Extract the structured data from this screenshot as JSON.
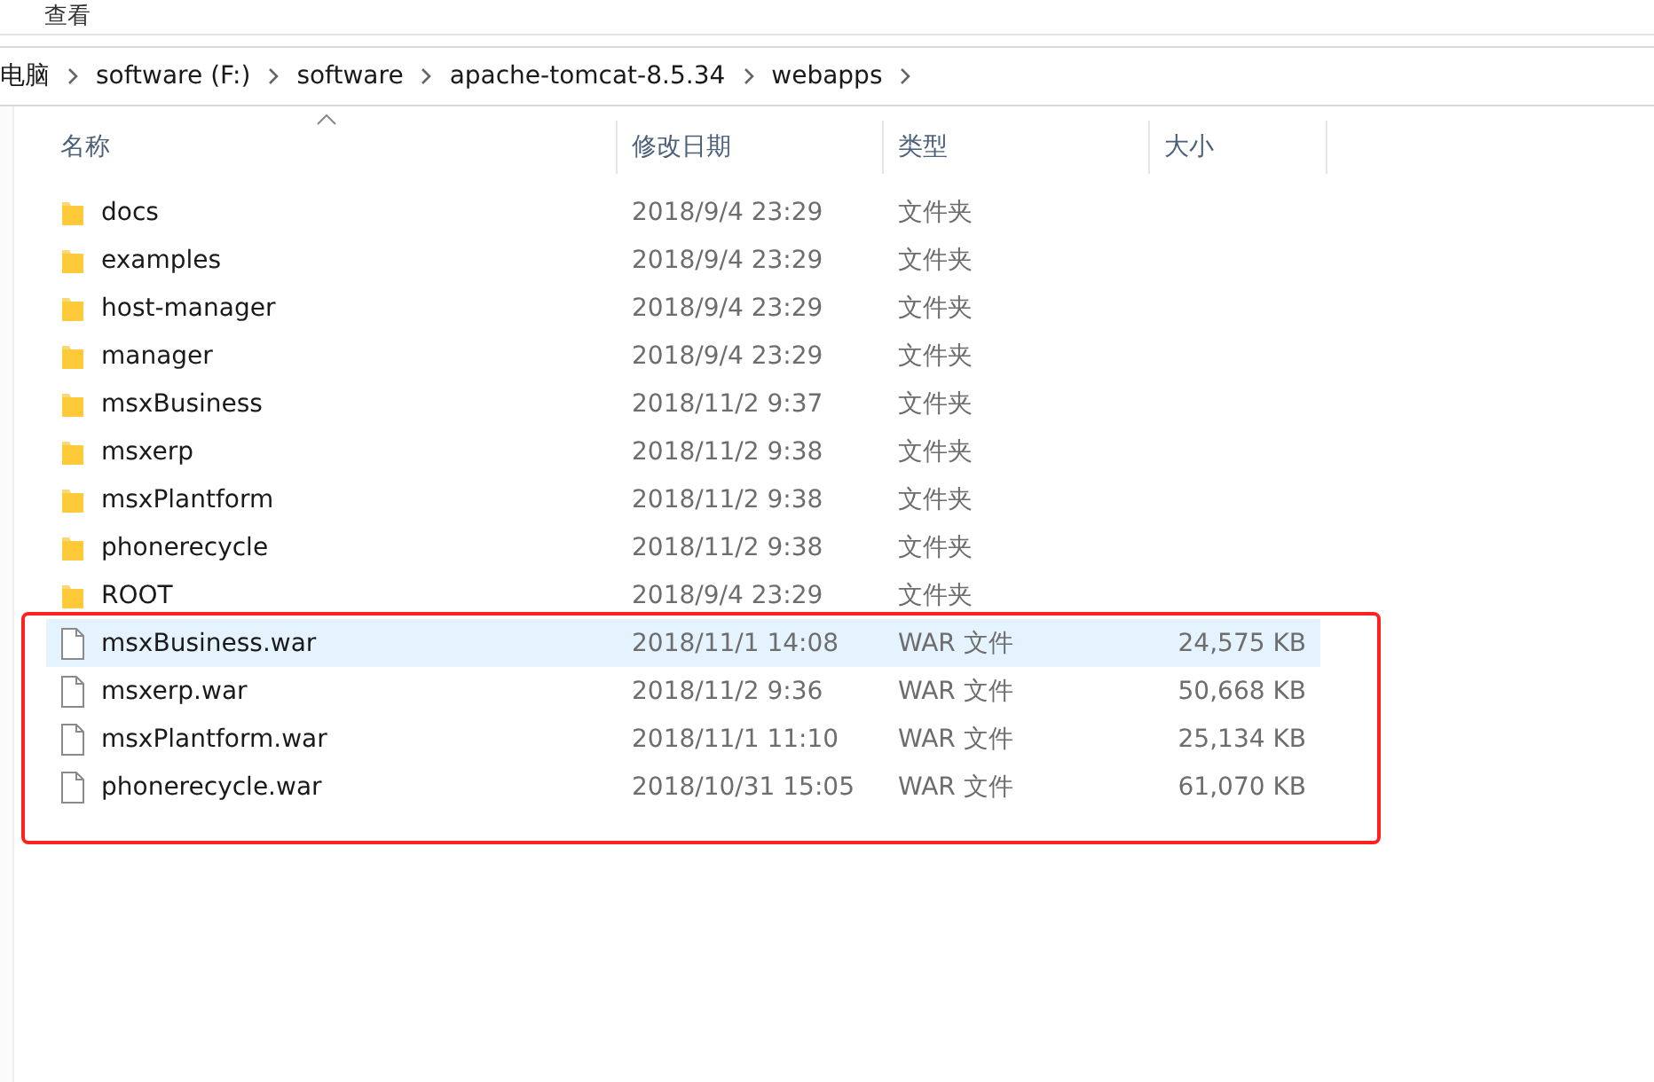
{
  "ribbon": {
    "tab": "查看"
  },
  "address": {
    "crumbs": [
      "电脑",
      "software (F:)",
      "software",
      "apache-tomcat-8.5.34",
      "webapps"
    ]
  },
  "columns": [
    {
      "label": "名称",
      "sorted": true
    },
    {
      "label": "修改日期",
      "sorted": false
    },
    {
      "label": "类型",
      "sorted": false
    },
    {
      "label": "大小",
      "sorted": false
    }
  ],
  "rows": [
    {
      "kind": "folder",
      "name": "docs",
      "date": "2018/9/4 23:29",
      "type": "文件夹",
      "selected": false
    },
    {
      "kind": "folder",
      "name": "examples",
      "date": "2018/9/4 23:29",
      "type": "文件夹",
      "selected": false
    },
    {
      "kind": "folder",
      "name": "host-manager",
      "date": "2018/9/4 23:29",
      "type": "文件夹",
      "selected": false
    },
    {
      "kind": "folder",
      "name": "manager",
      "date": "2018/9/4 23:29",
      "type": "文件夹",
      "selected": false
    },
    {
      "kind": "folder",
      "name": "msxBusiness",
      "date": "2018/11/2 9:37",
      "type": "文件夹",
      "selected": false
    },
    {
      "kind": "folder",
      "name": "msxerp",
      "date": "2018/11/2 9:38",
      "type": "文件夹",
      "selected": false
    },
    {
      "kind": "folder",
      "name": "msxPlantform",
      "date": "2018/11/2 9:38",
      "type": "文件夹",
      "selected": false
    },
    {
      "kind": "folder",
      "name": "phonerecycle",
      "date": "2018/11/2 9:38",
      "type": "文件夹",
      "selected": false
    },
    {
      "kind": "folder",
      "name": "ROOT",
      "date": "2018/9/4 23:29",
      "type": "文件夹",
      "selected": false
    },
    {
      "kind": "file",
      "name": "msxBusiness.war",
      "date": "2018/11/1 14:08",
      "type": "WAR 文件",
      "size": "24,575 KB",
      "selected": true
    },
    {
      "kind": "file",
      "name": "msxerp.war",
      "date": "2018/11/2 9:36",
      "type": "WAR 文件",
      "size": "50,668 KB",
      "selected": false
    },
    {
      "kind": "file",
      "name": "msxPlantform.war",
      "date": "2018/11/1 11:10",
      "type": "WAR 文件",
      "size": "25,134 KB",
      "selected": false
    },
    {
      "kind": "file",
      "name": "phonerecycle.war",
      "date": "2018/10/31 15:05",
      "type": "WAR 文件",
      "size": "61,070 KB",
      "selected": false
    }
  ],
  "annotation": {
    "kind": "box",
    "color": "#ff2020"
  }
}
